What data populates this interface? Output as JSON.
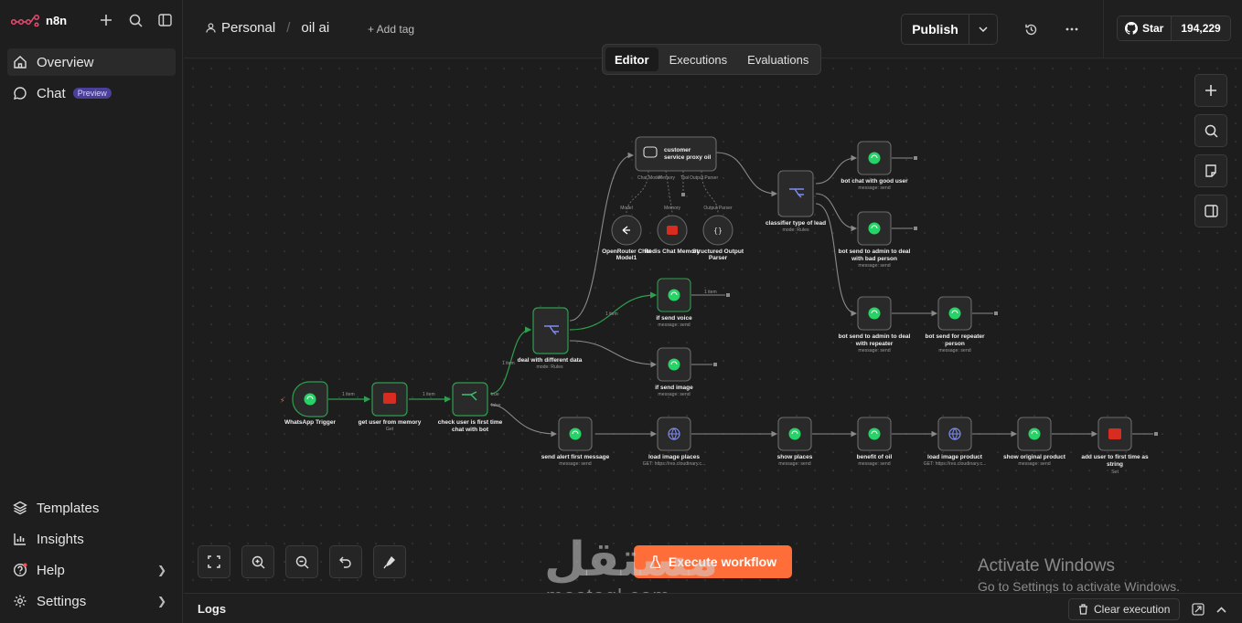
{
  "brand": {
    "name": "n8n"
  },
  "sidebar": {
    "overview": "Overview",
    "chat": "Chat",
    "chat_badge": "Preview",
    "templates": "Templates",
    "insights": "Insights",
    "help": "Help",
    "settings": "Settings"
  },
  "header": {
    "project": "Personal",
    "workflow": "oil ai",
    "add_tag": "+ Add tag",
    "publish": "Publish",
    "star": "Star",
    "star_count": "194,229"
  },
  "tabs": [
    "Editor",
    "Executions",
    "Evaluations"
  ],
  "nodes": {
    "trigger": {
      "title": "WhatsApp Trigger"
    },
    "get_user": {
      "title": "get user from memory",
      "sub": "Get"
    },
    "check_user": {
      "title1": "check user is first time",
      "title2": "chat with bot"
    },
    "deal_data": {
      "title": "deal with different data",
      "sub": "mode: Rules"
    },
    "agent": {
      "title1": "customer",
      "title2": "service proxy oil"
    },
    "agent_ports": [
      "Chat Model",
      "Memory",
      "Tool",
      "Output Parser"
    ],
    "model": {
      "label": "Model",
      "title1": "OpenRouter Chat",
      "title2": "Model1"
    },
    "memory": {
      "label": "Memory",
      "title": "Redis Chat Memory"
    },
    "parser": {
      "label": "Output Parser",
      "title1": "Structured Output",
      "title2": "Parser"
    },
    "classifier": {
      "title": "classifier type of lead",
      "sub": "mode: Rules"
    },
    "bot_good": {
      "title": "bot chat with good user",
      "sub": "message: send"
    },
    "bot_bad": {
      "title1": "bot send to admin to deal",
      "title2": "with bad person",
      "sub": "message: send"
    },
    "bot_repeater": {
      "title1": "bot send to admin to deal",
      "title2": "with repeater",
      "sub": "message: send"
    },
    "bot_repeater2": {
      "title1": "bot send for repeater",
      "title2": "person",
      "sub": "message: send"
    },
    "voice": {
      "title": "if send voice",
      "sub": "message: send"
    },
    "image": {
      "title": "if send image",
      "sub": "message: send"
    },
    "alert": {
      "title": "send alert first message",
      "sub": "message: send"
    },
    "load_places": {
      "title": "load image places",
      "sub": "GET: https://res.cloudinary.c..."
    },
    "show_places": {
      "title": "show places",
      "sub": "message: send"
    },
    "benefit": {
      "title": "benefit of oil",
      "sub": "message: send"
    },
    "load_product": {
      "title": "load image product",
      "sub": "GET: https://res.cloudinary.c..."
    },
    "show_product": {
      "title": "show original product",
      "sub": "message: send"
    },
    "add_user": {
      "title1": "add user to first time as",
      "title2": "string",
      "sub": "Set"
    }
  },
  "edges": {
    "item": "1 item",
    "true": "true",
    "false": "false"
  },
  "canvas": {
    "execute": "Execute workflow",
    "activate_title": "Activate Windows",
    "activate_sub": "Go to Settings to activate Windows.",
    "watermark_ar": "مستقل",
    "watermark_en": "mostaql.com"
  },
  "logs": {
    "label": "Logs",
    "clear": "Clear execution"
  },
  "colors": {
    "accent": "#ff6d39",
    "whatsapp": "#25d366",
    "redis": "#d82c20",
    "success_edge": "#2f9e4f"
  }
}
